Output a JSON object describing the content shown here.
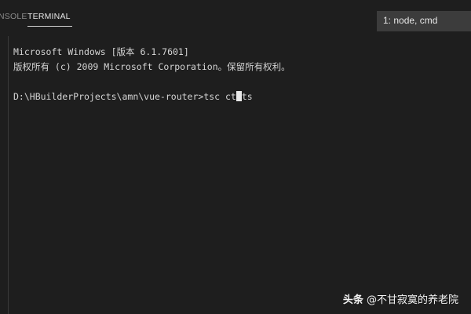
{
  "tabs": {
    "console": "NSOLE",
    "terminal": "TERMINAL"
  },
  "terminal_select": {
    "value": "1: node, cmd"
  },
  "terminal": {
    "line1": "Microsoft Windows [版本 6.1.7601]",
    "line2": "版权所有 (c) 2009 Microsoft Corporation。保留所有权利。",
    "prompt": "D:\\HBuilderProjects\\amn\\vue-router>",
    "command_before_cursor": "tsc ct",
    "command_after_cursor": "ts"
  },
  "watermark": {
    "brand": "头条",
    "author": " @不甘寂寞的养老院"
  }
}
